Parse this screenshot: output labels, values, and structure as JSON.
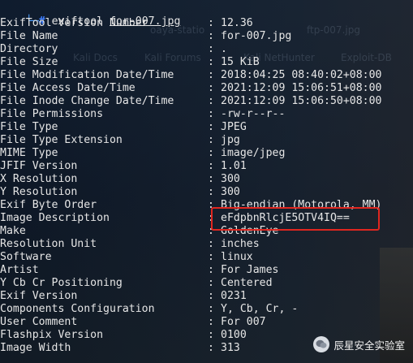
{
  "prompt": {
    "corner": "└─",
    "hash": "#",
    "command": "exiftool",
    "argument": "for-007.jpg"
  },
  "rows": [
    {
      "key": "ExifTool Version Number",
      "value": "12.36"
    },
    {
      "key": "File Name",
      "value": "for-007.jpg"
    },
    {
      "key": "Directory",
      "value": "."
    },
    {
      "key": "File Size",
      "value": "15 KiB"
    },
    {
      "key": "File Modification Date/Time",
      "value": "2018:04:25 08:40:02+08:00"
    },
    {
      "key": "File Access Date/Time",
      "value": "2021:12:09 15:06:51+08:00"
    },
    {
      "key": "File Inode Change Date/Time",
      "value": "2021:12:09 15:06:50+08:00"
    },
    {
      "key": "File Permissions",
      "value": "-rw-r--r--"
    },
    {
      "key": "File Type",
      "value": "JPEG"
    },
    {
      "key": "File Type Extension",
      "value": "jpg"
    },
    {
      "key": "MIME Type",
      "value": "image/jpeg"
    },
    {
      "key": "JFIF Version",
      "value": "1.01"
    },
    {
      "key": "X Resolution",
      "value": "300"
    },
    {
      "key": "Y Resolution",
      "value": "300"
    },
    {
      "key": "Exif Byte Order",
      "value": "Big-endian (Motorola, MM)"
    },
    {
      "key": "Image Description",
      "value": "eFdpbnRlcjE5OTV4IQ=="
    },
    {
      "key": "Make",
      "value": "GoldenEye"
    },
    {
      "key": "Resolution Unit",
      "value": "inches"
    },
    {
      "key": "Software",
      "value": "linux"
    },
    {
      "key": "Artist",
      "value": "For James"
    },
    {
      "key": "Y Cb Cr Positioning",
      "value": "Centered"
    },
    {
      "key": "Exif Version",
      "value": "0231"
    },
    {
      "key": "Components Configuration",
      "value": "Y, Cb, Cr, -"
    },
    {
      "key": "User Comment",
      "value": "For 007"
    },
    {
      "key": "Flashpix Version",
      "value": "0100"
    },
    {
      "key": "Image Width",
      "value": "313"
    }
  ],
  "separator": ":",
  "background_tabs": [
    "oaya-statio",
    "ftp-007.jpg",
    "Kali Docs",
    "Kali Forums",
    "Kali NetHunter",
    "Exploit-DB"
  ],
  "watermark": {
    "icon": "wechat-bubble-icon",
    "text": "辰星安全实验室"
  },
  "colors": {
    "highlight_box": "#e0261f",
    "prompt_blue": "#3f7fff"
  }
}
